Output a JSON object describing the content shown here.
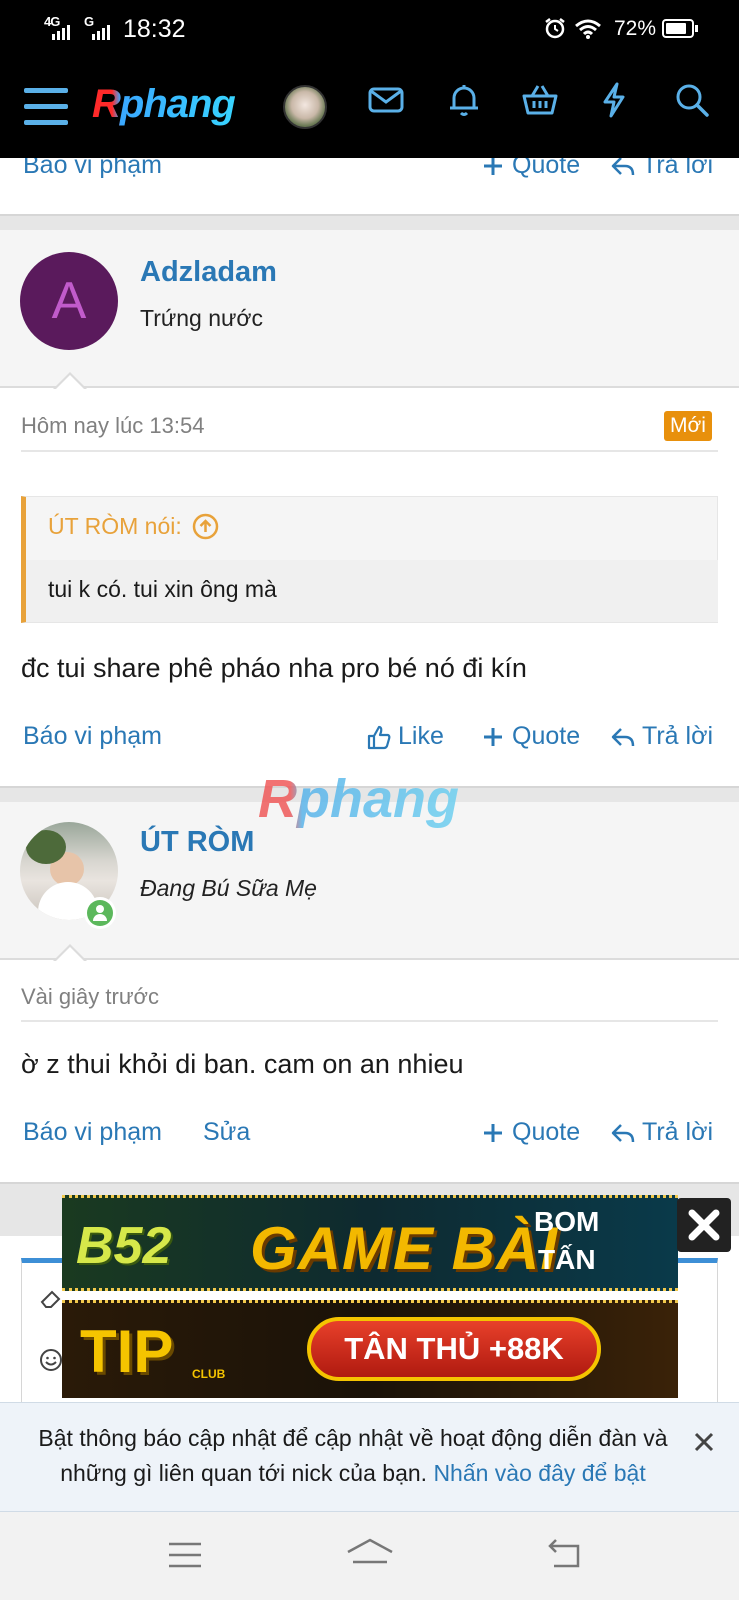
{
  "status_bar": {
    "network1": "4G",
    "network2": "G",
    "time": "18:32",
    "battery": "72%"
  },
  "navbar": {
    "logo_text": "Rphang",
    "icons": [
      "menu-icon",
      "user-avatar",
      "mail-icon",
      "bell-icon",
      "basket-icon",
      "lightning-icon",
      "search-icon"
    ]
  },
  "prev_post_actions": {
    "report": "Báo vi phạm",
    "quote": "Quote",
    "reply": "Trả lời"
  },
  "post1": {
    "avatar_letter": "A",
    "username": "Adzladam",
    "user_title": "Trứng nước",
    "time": "Hôm nay lúc 13:54",
    "new_badge": "Mới",
    "quote_author": "ÚT RÒM nói:",
    "quote_text": "tui k có. tui xin ông mà",
    "message": "đc tui share phê pháo nha pro bé nó đi kín",
    "report": "Báo vi phạm",
    "like": "Like",
    "quote": "Quote",
    "reply": "Trả lời"
  },
  "watermark": "Rphang",
  "post2": {
    "username": "ÚT RÒM",
    "user_title": "Đang Bú Sữa Mẹ",
    "time": "Vài giây trước",
    "message": "ờ z thui khỏi di ban. cam on an nhieu",
    "report": "Báo vi phạm",
    "edit": "Sửa",
    "quote": "Quote",
    "reply": "Trả lời"
  },
  "ads": {
    "ad1_brand": "B52",
    "ad1_title": "GAME BÀI",
    "ad1_sub1": "BOM",
    "ad1_sub2": "TẤN",
    "ad2_brand": "TIP",
    "ad2_brand_sub": "CLUB",
    "ad2_offer": "TÂN THỦ +88K"
  },
  "notification": {
    "text": "Bật thông báo cập nhật để cập nhật về hoạt động diễn đàn và những gì liên quan tới nick của bạn.",
    "link": "Nhấn vào đây để bật"
  },
  "colors": {
    "link": "#2a78b5",
    "badge": "#e8900c",
    "quote_accent": "#e8a23a",
    "avatar_bg": "#5a1a5c"
  }
}
